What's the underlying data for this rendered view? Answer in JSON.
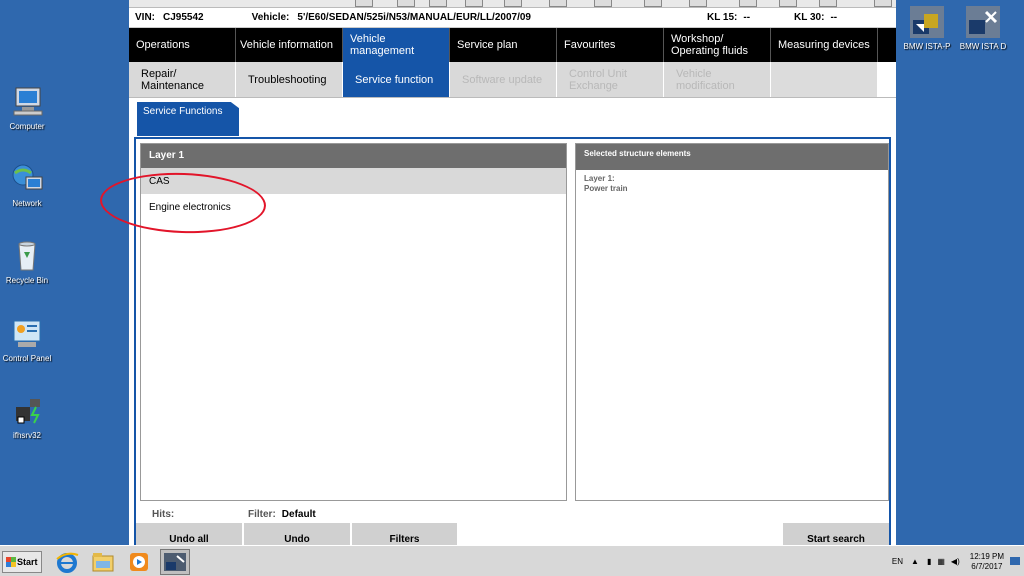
{
  "vehicle_info": {
    "vin_label": "VIN:",
    "vin": "CJ95542",
    "vehicle_label": "Vehicle:",
    "vehicle": "5'/E60/SEDAN/525i/N53/MANUAL/EUR/LL/2007/09",
    "kl15_label": "KL 15:",
    "kl15": "--",
    "kl30_label": "KL 30:",
    "kl30": "--"
  },
  "nav_main": [
    {
      "label": "Operations"
    },
    {
      "label": "Vehicle information"
    },
    {
      "label": "Vehicle management"
    },
    {
      "label": "Service plan"
    },
    {
      "label": "Favourites"
    },
    {
      "label": "Workshop/ Operating fluids"
    },
    {
      "label": "Measuring devices"
    }
  ],
  "nav_sub": [
    {
      "label": "Repair/ Maintenance"
    },
    {
      "label": "Troubleshooting"
    },
    {
      "label": "Service function"
    },
    {
      "label": "Software update"
    },
    {
      "label": "Control Unit Exchange"
    },
    {
      "label": "Vehicle modification"
    }
  ],
  "subtab": {
    "label": "Service Functions"
  },
  "left_panel": {
    "header": "Layer 1",
    "rows": [
      "CAS",
      "Engine electronics"
    ]
  },
  "right_panel": {
    "header": "Selected structure elements",
    "layer_label": "Layer 1:",
    "layer_value": "Power train"
  },
  "bottom": {
    "hits_label": "Hits:",
    "filter_label": "Filter:",
    "filter_value": "Default",
    "undo_all": "Undo all",
    "undo": "Undo",
    "filters": "Filters",
    "start_search": "Start search"
  },
  "desktop_icons": [
    {
      "label": "Computer",
      "icon": "computer-icon"
    },
    {
      "label": "Network",
      "icon": "network-icon"
    },
    {
      "label": "Recycle Bin",
      "icon": "recycle-bin-icon"
    },
    {
      "label": "Control Panel",
      "icon": "control-panel-icon"
    },
    {
      "label": "ifhsrv32",
      "icon": "ifhsrv-icon"
    },
    {
      "label": "BMW ISTA-P",
      "icon": "ista-p-icon"
    },
    {
      "label": "BMW ISTA D",
      "icon": "ista-d-icon"
    }
  ],
  "taskbar": {
    "start_label": "Start",
    "language": "EN",
    "time": "12:19 PM",
    "date": "6/7/2017"
  },
  "colors": {
    "accent": "#1555a8",
    "desktop": "#2f68ae",
    "annotation": "#e2152a"
  }
}
